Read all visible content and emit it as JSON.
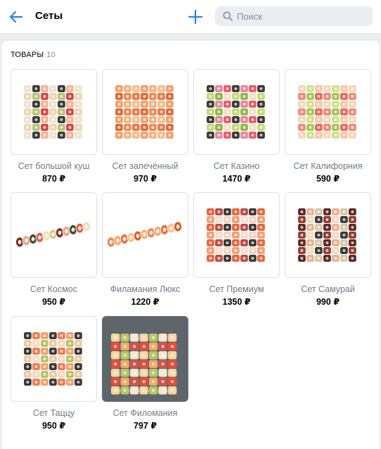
{
  "header": {
    "title": "Сеты",
    "search_placeholder": "Поиск"
  },
  "section": {
    "title": "Товары",
    "count": "10"
  },
  "products": [
    {
      "name": "Сет большой куш",
      "price": "870 ₽",
      "style": "mixed"
    },
    {
      "name": "Сет запечённый",
      "price": "970 ₽",
      "style": "baked"
    },
    {
      "name": "Сет Казино",
      "price": "1470 ₽",
      "style": "colorful"
    },
    {
      "name": "Сет Калифорния",
      "price": "590 ₽",
      "style": "california"
    },
    {
      "name": "Сет Космос",
      "price": "950 ₽",
      "style": "row-mixed"
    },
    {
      "name": "Филамания Люкс",
      "price": "1220 ₽",
      "style": "row-salmon"
    },
    {
      "name": "Сет Премиум",
      "price": "1350 ₽",
      "style": "premium"
    },
    {
      "name": "Сет Самурай",
      "price": "990 ₽",
      "style": "samurai"
    },
    {
      "name": "Сет Таццу",
      "price": "950 ₽",
      "style": "tazzu"
    },
    {
      "name": "Сет Филомания",
      "price": "797 ₽",
      "style": "dark"
    }
  ],
  "colors": {
    "accent": "#2d81e0",
    "background": "#edeef0",
    "muted_text": "#6d7885"
  },
  "icons": {
    "back": "arrow-left-icon",
    "add": "plus-icon",
    "search": "search-icon"
  }
}
